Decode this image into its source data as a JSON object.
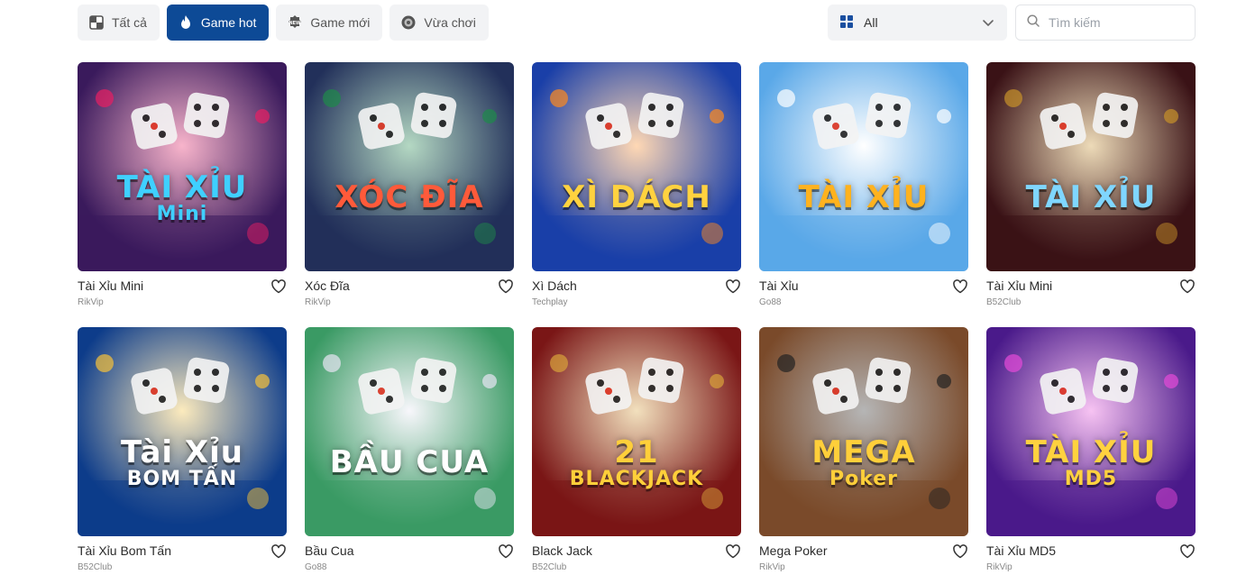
{
  "tabs": [
    {
      "label": "Tất cả",
      "icon": "all-games-icon"
    },
    {
      "label": "Game hot",
      "icon": "flame-icon",
      "active": true
    },
    {
      "label": "Game mới",
      "icon": "new-badge-icon"
    },
    {
      "label": "Vừa chơi",
      "icon": "recent-play-icon"
    }
  ],
  "filter": {
    "value": "All",
    "icon": "grid-icon"
  },
  "search": {
    "placeholder": "Tìm kiếm"
  },
  "games": [
    {
      "name": "Tài Xỉu Mini",
      "provider": "RikVip",
      "logo1": "TÀI XỈU",
      "logo2": "Mini",
      "bg": "#3a1a5c",
      "accent": "#e91e63",
      "text": "#3fd0ff"
    },
    {
      "name": "Xóc Đĩa",
      "provider": "RikVip",
      "logo1": "XÓC ĐĨA",
      "logo2": "",
      "bg": "#22305a",
      "accent": "#1e8a4a",
      "text": "#ff5a3a"
    },
    {
      "name": "Xì Dách",
      "provider": "Techplay",
      "logo1": "XÌ DÁCH",
      "logo2": "",
      "bg": "#1a3fa8",
      "accent": "#ff8a1e",
      "text": "#ffd23f"
    },
    {
      "name": "Tài Xỉu",
      "provider": "Go88",
      "logo1": "TÀI XỈU",
      "logo2": "",
      "bg": "#5aa8e8",
      "accent": "#ffffff",
      "text": "#ffb21e"
    },
    {
      "name": "Tài Xỉu Mini",
      "provider": "B52Club",
      "logo1": "TÀI XỈU",
      "logo2": "",
      "bg": "#3a1216",
      "accent": "#c8912a",
      "text": "#7fd6ff"
    },
    {
      "name": "Tài Xỉu Bom Tấn",
      "provider": "B52Club",
      "logo1": "Tài Xỉu",
      "logo2": "BOM TẤN",
      "bg": "#0d3c8a",
      "accent": "#f6c23a",
      "text": "#ffffff"
    },
    {
      "name": "Bầu Cua",
      "provider": "Go88",
      "logo1": "BẦU CUA",
      "logo2": "",
      "bg": "#3a9a64",
      "accent": "#e8e6f4",
      "text": "#ffffff"
    },
    {
      "name": "Black Jack",
      "provider": "B52Club",
      "logo1": "21",
      "logo2": "BLACKJACK",
      "bg": "#7a1616",
      "accent": "#d8a23a",
      "text": "#ffcf3a"
    },
    {
      "name": "Mega Poker",
      "provider": "RikVip",
      "logo1": "MEGA",
      "logo2": "Poker",
      "bg": "#7a4a2a",
      "accent": "#222222",
      "text": "#ffcf3a"
    },
    {
      "name": "Tài Xỉu MD5",
      "provider": "RikVip",
      "logo1": "TÀI XỈU",
      "logo2": "MD5",
      "bg": "#4a1a8a",
      "accent": "#e64ad8",
      "text": "#ffd23f"
    }
  ]
}
